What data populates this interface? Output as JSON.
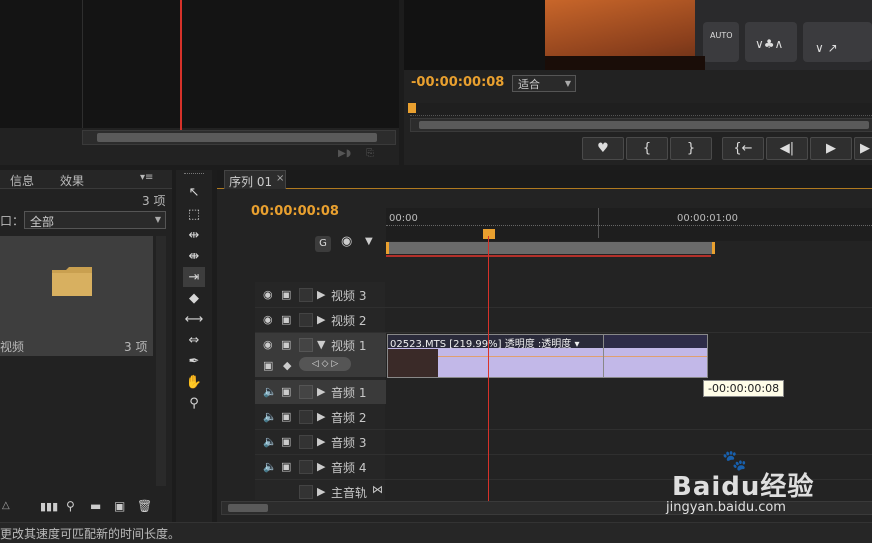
{
  "monitor": {
    "timecode": "-00:00:00:08",
    "fit_label": "适合",
    "buttons": [
      "mark-in",
      "bracket-in",
      "bracket-out",
      "go-to-in",
      "step-back",
      "play",
      "more"
    ]
  },
  "project_panel": {
    "tabs": [
      "信息",
      "效果"
    ],
    "item_count": "3 项",
    "filter_label": "口：",
    "filter_value": "全部",
    "bin_name": "视频",
    "bin_count": "3 项",
    "menu_icon": "▾≡"
  },
  "sequence": {
    "tab_label": "序列 01",
    "tab_close": "×",
    "timecode": "00:00:00:08",
    "ruler": [
      "00:00",
      "00:00:01:00"
    ],
    "tracks_video": [
      "视频 3",
      "视频 2",
      "视频 1"
    ],
    "tracks_audio": [
      "音频 1",
      "音频 2",
      "音频 3",
      "音频 4"
    ],
    "master": "主音轨",
    "clip_label": "02523.MTS [219.99%]  透明度 :透明度 ▾",
    "tooltip": "-00:00:00:08"
  },
  "status_bar": {
    "text": "更改其速度可匹配新的时间长度。"
  },
  "watermark": {
    "line1": "Baidu经验",
    "line2": "jingyan.baidu.com"
  },
  "colors": {
    "accent_orange": "#e9a02f",
    "playhead_red": "#d6322a",
    "clip_lavender": "#c2b8e8"
  }
}
